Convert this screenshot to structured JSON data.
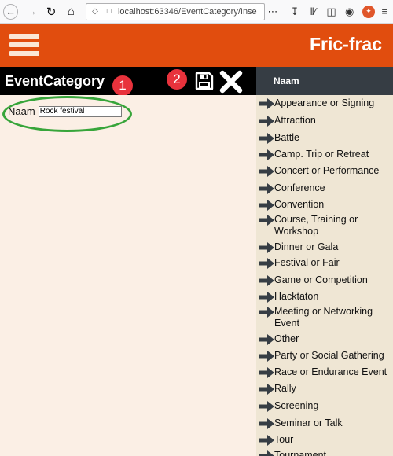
{
  "browser": {
    "url": "localhost:63346/EventCategory/Inse"
  },
  "app": {
    "brand": "Fric-frac"
  },
  "titlebar": {
    "title": "EventCategory",
    "badge1": "1",
    "badge2": "2"
  },
  "form": {
    "label": "Naam",
    "value": "Rock festival"
  },
  "sidebar": {
    "header": "Naam",
    "items": [
      "Appearance or Signing",
      "Attraction",
      "Battle",
      "Camp. Trip or Retreat",
      "Concert or Performance",
      "Conference",
      "Convention",
      "Course, Training or Workshop",
      "Dinner or Gala",
      "Festival or Fair",
      "Game or Competition",
      "Hacktaton",
      "Meeting or Networking Event",
      "Other",
      "Party or Social Gathering",
      "Race or Endurance Event",
      "Rally",
      "Screening",
      "Seminar or Talk",
      "Tour",
      "Tournament"
    ]
  },
  "colors": {
    "header": "#e14d0e",
    "badge": "#e8323c",
    "highlight": "#37a53a",
    "sidebar_head": "#363d44"
  }
}
